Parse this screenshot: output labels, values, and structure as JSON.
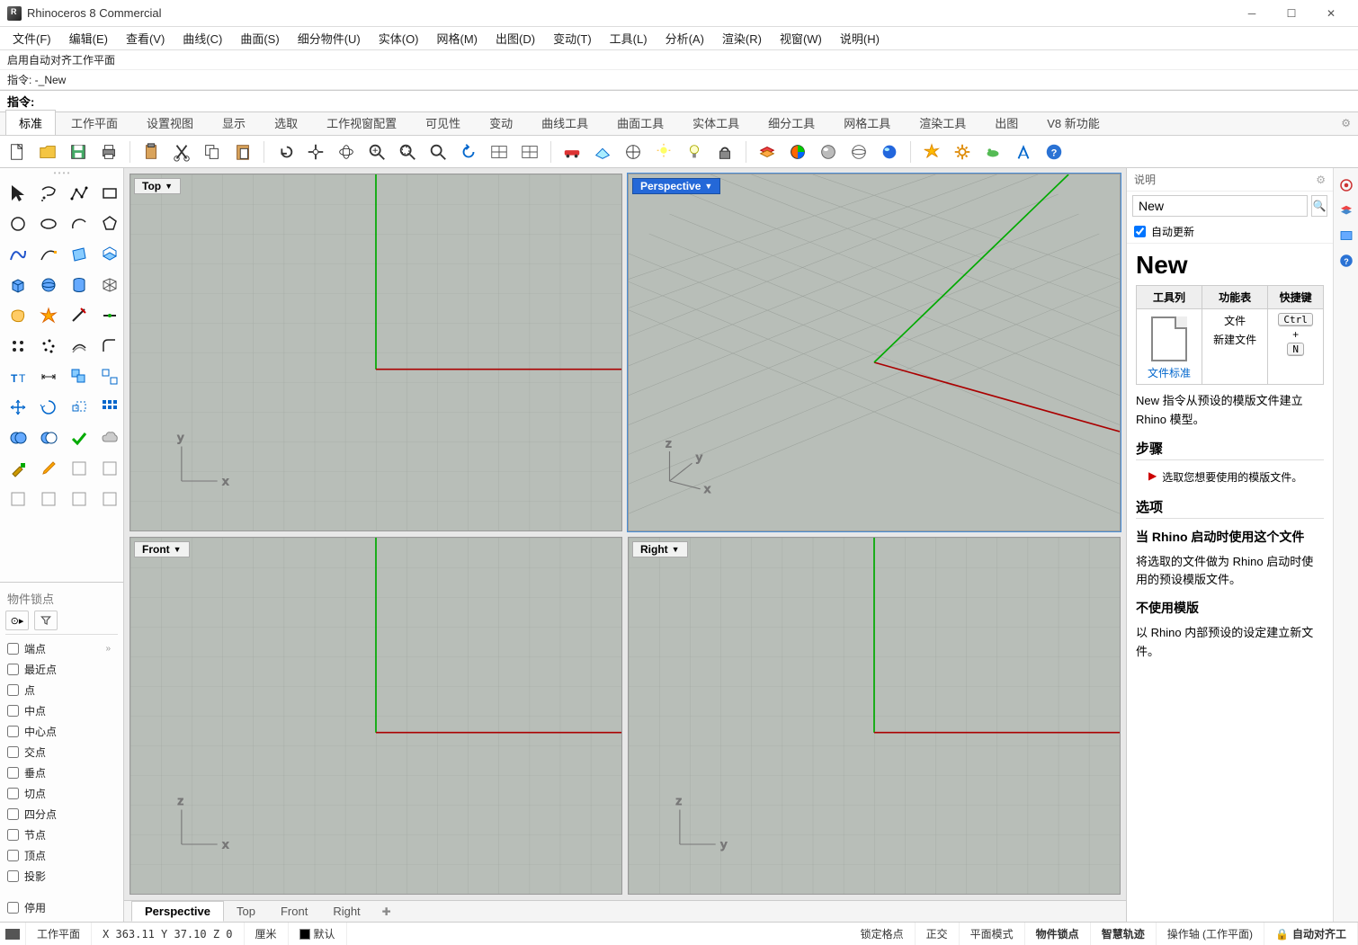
{
  "app": {
    "title": "Rhinoceros 8 Commercial"
  },
  "menu": [
    "文件(F)",
    "编辑(E)",
    "查看(V)",
    "曲线(C)",
    "曲面(S)",
    "细分物件(U)",
    "实体(O)",
    "网格(M)",
    "出图(D)",
    "变动(T)",
    "工具(L)",
    "分析(A)",
    "渲染(R)",
    "视窗(W)",
    "说明(H)"
  ],
  "history": [
    "启用自动对齐工作平面",
    "指令: -_New"
  ],
  "cmd_label": "指令:",
  "cmd_value": "",
  "tool_tabs": [
    "标准",
    "工作平面",
    "设置视图",
    "显示",
    "选取",
    "工作视窗配置",
    "可见性",
    "变动",
    "曲线工具",
    "曲面工具",
    "实体工具",
    "细分工具",
    "网格工具",
    "渲染工具",
    "出图",
    "V8 新功能"
  ],
  "tool_tabs_active": 0,
  "viewports": {
    "top": {
      "label": "Top",
      "axes": [
        "x",
        "y"
      ]
    },
    "perspective": {
      "label": "Perspective",
      "axes": [
        "x",
        "y",
        "z"
      ],
      "active": true
    },
    "front": {
      "label": "Front",
      "axes": [
        "x",
        "z"
      ]
    },
    "right": {
      "label": "Right",
      "axes": [
        "y",
        "z"
      ]
    }
  },
  "view_tabs": [
    "Perspective",
    "Top",
    "Front",
    "Right"
  ],
  "view_tabs_active": 0,
  "osnap": {
    "header": "物件锁点",
    "items": [
      "端点",
      "最近点",
      "点",
      "中点",
      "中心点",
      "交点",
      "垂点",
      "切点",
      "四分点",
      "节点",
      "顶点",
      "投影"
    ],
    "pause": "停用"
  },
  "help": {
    "panel_title": "说明",
    "search_value": "New",
    "auto_update": "自动更新",
    "heading": "New",
    "th1": "工具列",
    "th2": "功能表",
    "th3": "快捷键",
    "col1_link": "文件标准",
    "col2_line1": "文件",
    "col2_line2": "新建文件",
    "kb1": "Ctrl",
    "kb_plus": "+",
    "kb2": "N",
    "desc": "New 指令从预设的模版文件建立 Rhino 模型。",
    "steps_h": "步骤",
    "step1": "选取您想要使用的模版文件。",
    "options_h": "选项",
    "opt1_h": "当 Rhino 启动时使用这个文件",
    "opt1_b": "将选取的文件做为 Rhino 启动时使用的预设模版文件。",
    "opt2_h": "不使用模版",
    "opt2_b": "以 Rhino 内部预设的设定建立新文件。"
  },
  "status": {
    "cplane": "工作平面",
    "coords": "X 363.11 Y 37.10 Z 0",
    "unit": "厘米",
    "layer": "默认",
    "items": [
      "锁定格点",
      "正交",
      "平面模式",
      "物件锁点",
      "智慧轨迹",
      "操作轴 (工作平面)",
      "自动对齐工"
    ],
    "bold": [
      3,
      4,
      6
    ]
  }
}
